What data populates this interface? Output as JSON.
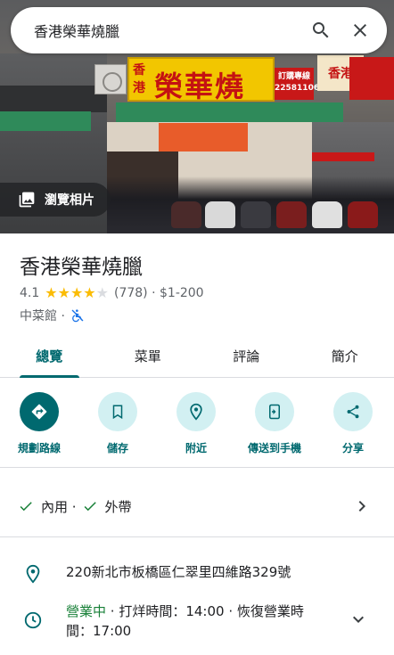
{
  "search": {
    "query": "香港榮華燒臘"
  },
  "hero": {
    "gallery_label": "瀏覽相片",
    "sign_small": "香港",
    "sign_big": "榮華燒臘",
    "sign_phone_top": "訂購專線",
    "sign_phone": "22581106",
    "sign_right": "香港"
  },
  "place": {
    "name": "香港榮華燒臘",
    "rating": "4.1",
    "rating_value": 4.1,
    "reviews": "(778)",
    "price": "$1-200",
    "category": "中菜館 ·",
    "accessibility_icon": "wheelchair-not-accessible-icon"
  },
  "tabs": [
    {
      "label": "總覽",
      "active": true
    },
    {
      "label": "菜單",
      "active": false
    },
    {
      "label": "評論",
      "active": false
    },
    {
      "label": "簡介",
      "active": false
    }
  ],
  "actions": [
    {
      "label": "規劃路線",
      "icon": "directions-icon"
    },
    {
      "label": "儲存",
      "icon": "bookmark-icon"
    },
    {
      "label": "附近",
      "icon": "nearby-icon"
    },
    {
      "label": "傳送到手機",
      "icon": "send-to-phone-icon"
    },
    {
      "label": "分享",
      "icon": "share-icon"
    }
  ],
  "service": {
    "dine_in": "內用 ·",
    "takeout": "外帶"
  },
  "address": "220新北市板橋區仁翠里四維路329號",
  "hours": {
    "status": "營業中",
    "rest_line1": " · 打烊時間：14:00 · 恢復營業時",
    "rest_line2": "間：17:00"
  },
  "colors": {
    "accent": "#00696f",
    "accent_light": "#d2f0f2",
    "star": "#fbbc04",
    "open": "#188038"
  }
}
